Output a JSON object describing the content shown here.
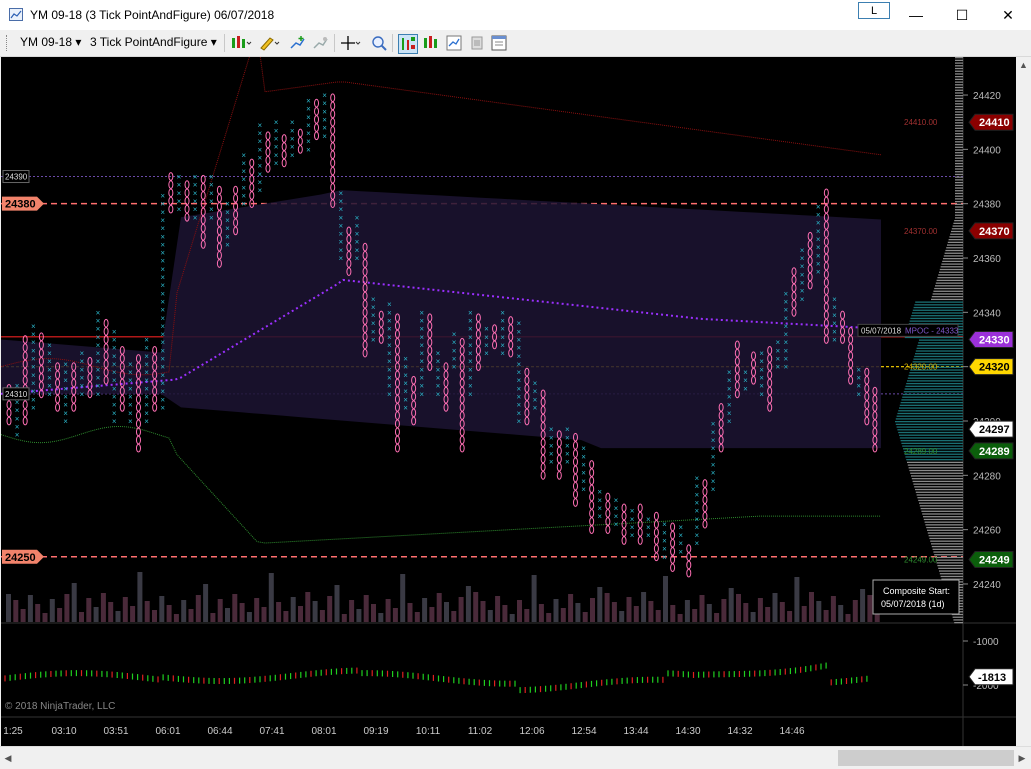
{
  "window": {
    "title": "YM 09-18 (3 Tick PointAndFigure)  06/07/2018",
    "l_button": "L",
    "minimize": "—",
    "maximize": "☐",
    "close": "✕"
  },
  "toolbar": {
    "instrument": "YM 09-18",
    "period": "3 Tick PointAndFigure",
    "dropdown_arrow": "▾",
    "icons": [
      "bar-style-icon",
      "pencil-draw-icon",
      "add-indicator-icon",
      "strategy-icon",
      "crosshair-icon",
      "zoom-icon",
      "chart-trader-icon",
      "data-series-icon",
      "properties-icon",
      "share-icon",
      "template-icon"
    ]
  },
  "chart": {
    "price_axis": {
      "ticks": [
        "24420",
        "24400",
        "24380",
        "24360",
        "24340",
        "24320",
        "24300",
        "24280",
        "24260",
        "24240"
      ],
      "price_min": 24226,
      "price_max": 24434
    },
    "price_labels": [
      {
        "text": "24410",
        "price": 24410,
        "color": "#8b0000",
        "text_color": "#ffffff"
      },
      {
        "text": "24370",
        "price": 24370,
        "color": "#8b0000",
        "text_color": "#ffffff"
      },
      {
        "text": "24330",
        "price": 24330,
        "color": "#9b30d9",
        "text_color": "#ffffff"
      },
      {
        "text": "24320",
        "price": 24320,
        "color": "#ffd700",
        "text_color": "#000000"
      },
      {
        "text": "24297",
        "price": 24297,
        "color": "#ffffff",
        "text_color": "#000000"
      },
      {
        "text": "24289",
        "price": 24289,
        "color": "#0b5e0b",
        "text_color": "#ffffff"
      },
      {
        "text": "24249",
        "price": 24249,
        "color": "#0b5e0b",
        "text_color": "#ffffff"
      }
    ],
    "left_labels": [
      {
        "text": "24390",
        "price": 24390,
        "type": "plain"
      },
      {
        "text": "24380",
        "price": 24380,
        "type": "salmon"
      },
      {
        "text": "24310",
        "price": 24310,
        "type": "plain"
      },
      {
        "text": "24250",
        "price": 24250,
        "type": "salmon"
      }
    ],
    "annotations": {
      "mpoc_date": "05/07/2018",
      "mpoc_text": "MPOC - 24333",
      "small_24410": "24410.00",
      "small_24370": "24370.00",
      "small_24320": "24320.00",
      "small_24289": "24289.00",
      "small_24249": "24249.00",
      "composite_title": "Composite Start:",
      "composite_date": "05/07/2018 (1d)",
      "copyright": "© 2018 NinjaTrader, LLC"
    },
    "lower_axis": {
      "ticks": [
        "-1000",
        "-2000"
      ],
      "current_value": "-1813"
    },
    "time_axis": [
      "1:25",
      "03:10",
      "03:51",
      "06:01",
      "06:44",
      "07:41",
      "08:01",
      "09:19",
      "10:11",
      "11:02",
      "12:06",
      "12:54",
      "13:44",
      "14:30",
      "14:32",
      "14:46"
    ],
    "colors": {
      "x_mark": "#2ab4c8",
      "o_mark": "#ff6fb4",
      "resistance": "#ff6f6f",
      "vwap": "#9b30ff",
      "poc": "#ffd700",
      "upper_band": "#8b1010",
      "lower_band": "#2e8b2e"
    }
  }
}
